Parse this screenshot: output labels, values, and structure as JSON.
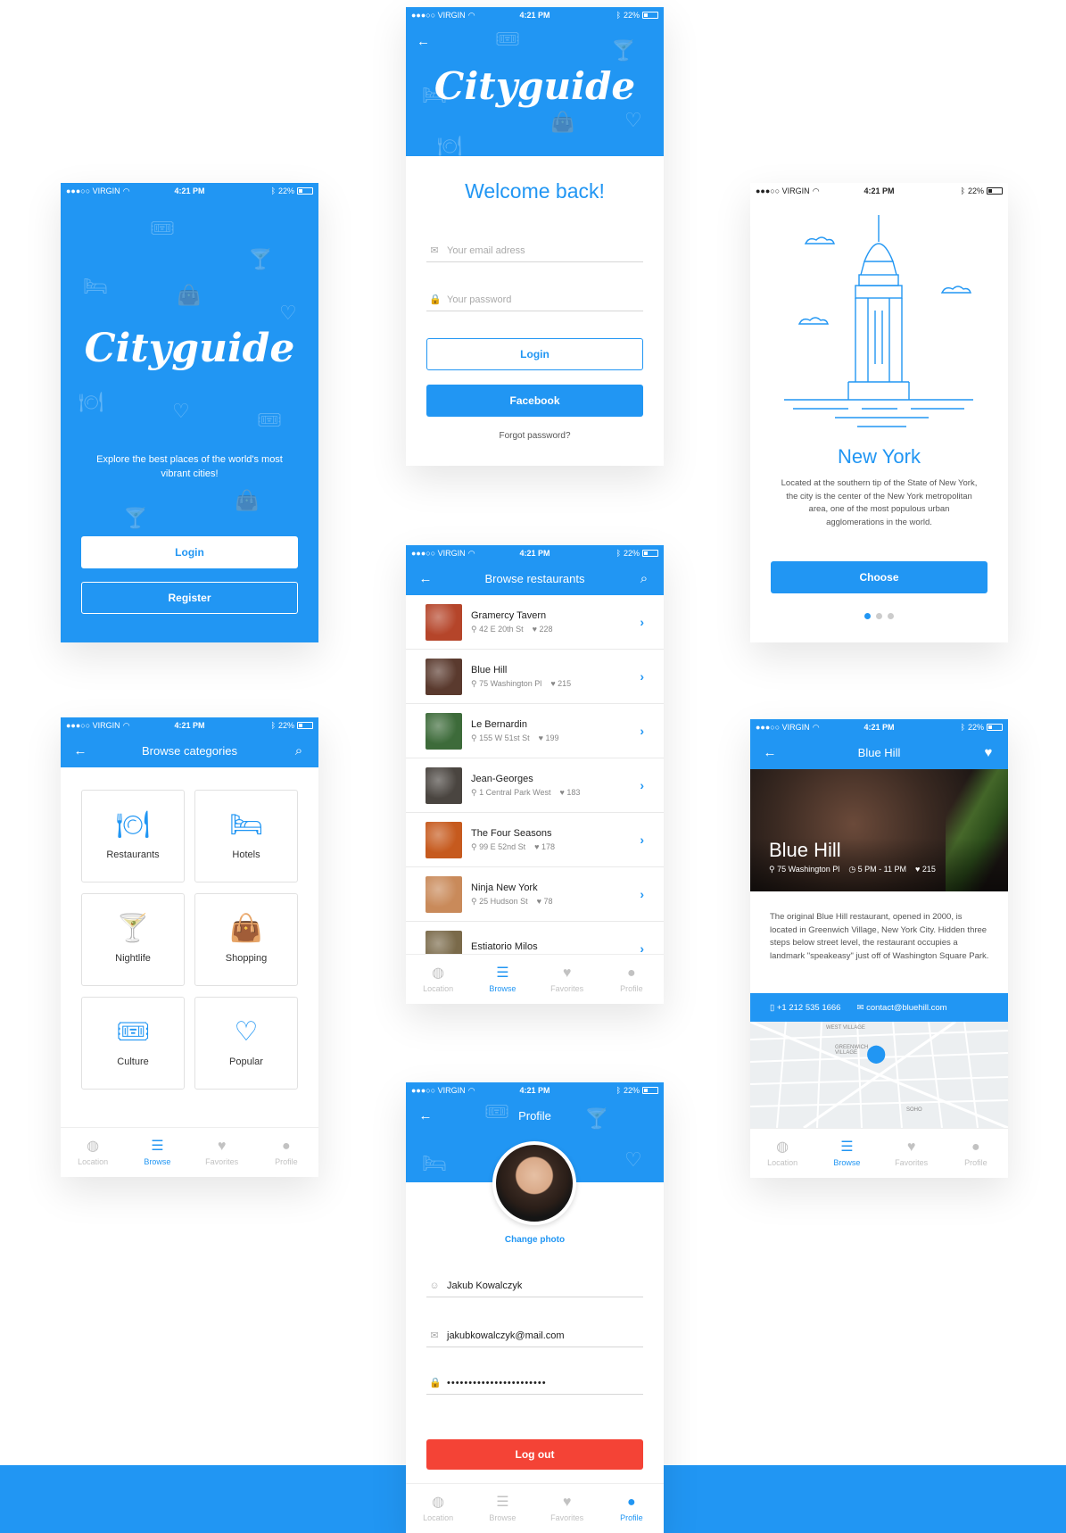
{
  "status": {
    "carrier": "●●●○○ VIRGIN",
    "time": "4:21 PM",
    "battery": "22%"
  },
  "splash": {
    "logo": "Cityguide",
    "tagline": "Explore the best places of the world's most vibrant cities!",
    "login": "Login",
    "register": "Register"
  },
  "login": {
    "logo": "Cityguide",
    "welcome": "Welcome back!",
    "email_placeholder": "Your email adress",
    "password_placeholder": "Your password",
    "login_button": "Login",
    "facebook_button": "Facebook",
    "forgot": "Forgot password?"
  },
  "city": {
    "name": "New York",
    "description": "Located at the southern tip of the State of New York, the city is the center of the New York metropolitan area, one of the most populous urban agglomerations in the world.",
    "choose": "Choose",
    "page_index": 1,
    "page_count": 3
  },
  "categories": {
    "title": "Browse categories",
    "items": [
      {
        "label": "Restaurants",
        "icon": "cloche-icon"
      },
      {
        "label": "Hotels",
        "icon": "bed-icon"
      },
      {
        "label": "Nightlife",
        "icon": "cocktail-icon"
      },
      {
        "label": "Shopping",
        "icon": "bag-icon"
      },
      {
        "label": "Culture",
        "icon": "ticket-icon"
      },
      {
        "label": "Popular",
        "icon": "heart-icon"
      }
    ]
  },
  "restaurants": {
    "title": "Browse restaurants",
    "items": [
      {
        "name": "Gramercy Tavern",
        "address": "42 E 20th St",
        "likes": "228",
        "color": "#b5452a"
      },
      {
        "name": "Blue Hill",
        "address": "75 Washington Pl",
        "likes": "215",
        "color": "#5a3a2e"
      },
      {
        "name": "Le Bernardin",
        "address": "155 W 51st St",
        "likes": "199",
        "color": "#3d6b3a"
      },
      {
        "name": "Jean-Georges",
        "address": "1 Central Park West",
        "likes": "183",
        "color": "#4a4540"
      },
      {
        "name": "The Four Seasons",
        "address": "99 E 52nd St",
        "likes": "178",
        "color": "#c65a1e"
      },
      {
        "name": "Ninja New York",
        "address": "25 Hudson St",
        "likes": "78",
        "color": "#c98a5a"
      },
      {
        "name": "Estiatorio Milos",
        "address": "",
        "likes": "",
        "color": "#7a6a4a"
      }
    ]
  },
  "detail": {
    "title": "Blue Hill",
    "hero_name": "Blue Hill",
    "address": "75 Washington Pl",
    "hours": "5 PM - 11 PM",
    "likes": "215",
    "description": "The original Blue Hill restaurant, opened in 2000, is located in Greenwich Village, New York City. Hidden three steps below street level, the restaurant occupies a landmark \"speakeasy\" just off of Washington Square Park.",
    "phone": "+1 212 535 1666",
    "email": "contact@bluehill.com",
    "map_labels": {
      "area1": "WEST VILLAGE",
      "area2": "GREENWICH VILLAGE",
      "area3": "SOHO"
    }
  },
  "profile": {
    "title": "Profile",
    "change_photo": "Change photo",
    "name": "Jakub Kowalczyk",
    "email": "jakubkowalczyk@mail.com",
    "password": "•••••••••••••••••••••••",
    "logout": "Log out"
  },
  "tabs": {
    "location": "Location",
    "browse": "Browse",
    "favorites": "Favorites",
    "profile": "Profile"
  },
  "colors": {
    "accent": "#2196f3",
    "danger": "#f44336"
  }
}
